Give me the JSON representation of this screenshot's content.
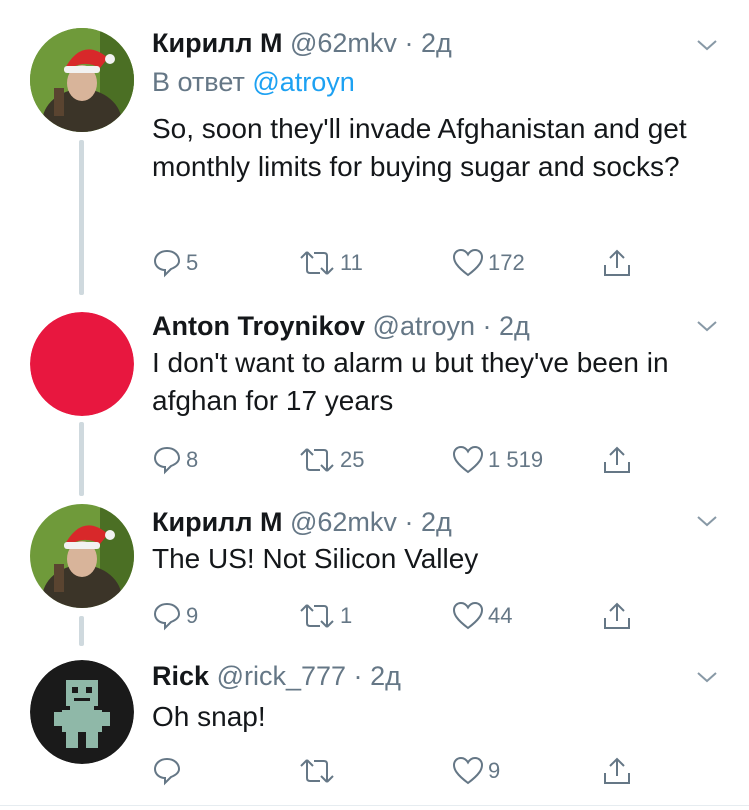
{
  "tweets": [
    {
      "name": "Кирилл М",
      "handle": "@62mkv",
      "dot": "·",
      "time": "2д",
      "reply_prefix": "В ответ",
      "reply_mention": "@atroyn",
      "text": "So, soon they'll invade Afghanistan and get monthly limits for buying sugar and socks?",
      "replies": "5",
      "retweets": "11",
      "likes": "172",
      "avatar": "person-in-santa-hat"
    },
    {
      "name": "Anton Troynikov",
      "handle": "@atroyn",
      "dot": "·",
      "time": "2д",
      "text": "I don't want to alarm u but they've been in afghan for 17 years",
      "replies": "8",
      "retweets": "25",
      "likes": "1 519",
      "avatar": "red-circle",
      "avatar_color": "#e8173f"
    },
    {
      "name": "Кирилл М",
      "handle": "@62mkv",
      "dot": "·",
      "time": "2д",
      "text": "The US! Not Silicon Valley",
      "replies": "9",
      "retweets": "1",
      "likes": "44",
      "avatar": "person-in-santa-hat"
    },
    {
      "name": "Rick",
      "handle": "@rick_777",
      "dot": "·",
      "time": "2д",
      "text": "Oh snap!",
      "replies": "",
      "retweets": "",
      "likes": "9",
      "avatar": "pixel-robot"
    }
  ],
  "icons": {
    "reply": "reply-icon",
    "retweet": "retweet-icon",
    "like": "heart-icon",
    "share": "share-icon",
    "caret": "chevron-down-icon"
  },
  "colors": {
    "link": "#1da1f2",
    "secondary": "#657786",
    "thread_line": "#cfd9de"
  }
}
